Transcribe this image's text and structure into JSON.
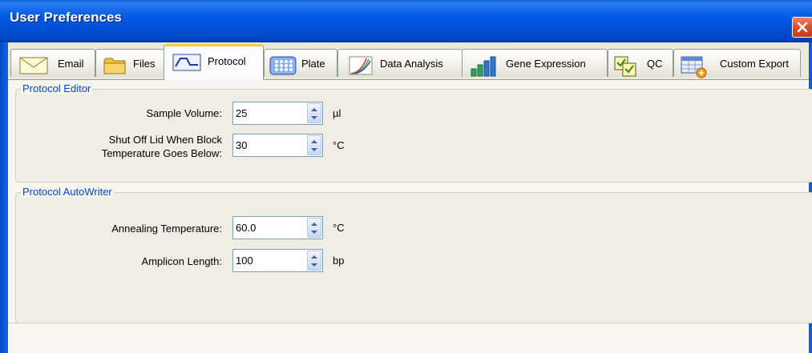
{
  "window": {
    "title": "User Preferences",
    "close_icon": "close-icon"
  },
  "tabs": [
    {
      "label": "Email",
      "icon": "envelope-icon",
      "active": false
    },
    {
      "label": "Files",
      "icon": "folder-icon",
      "active": false
    },
    {
      "label": "Protocol",
      "icon": "protocol-wave-icon",
      "active": true
    },
    {
      "label": "Plate",
      "icon": "plate-grid-icon",
      "active": false
    },
    {
      "label": "Data Analysis",
      "icon": "data-analysis-curves-icon",
      "active": false
    },
    {
      "label": "Gene Expression",
      "icon": "bar-chart-icon",
      "active": false
    },
    {
      "label": "QC",
      "icon": "qc-checkboxes-icon",
      "active": false
    },
    {
      "label": "Custom Export",
      "icon": "export-table-icon",
      "active": false
    }
  ],
  "protocol_editor": {
    "title": "Protocol Editor",
    "sample_volume": {
      "label": "Sample Volume:",
      "value": "25",
      "unit": "µl"
    },
    "shut_off_lid": {
      "label_line1": "Shut Off Lid When Block",
      "label_line2": "Temperature Goes Below:",
      "value": "30",
      "unit": "°C"
    }
  },
  "protocol_autowriter": {
    "title": "Protocol AutoWriter",
    "annealing_temperature": {
      "label": "Annealing Temperature:",
      "value": "60.0",
      "unit": "°C"
    },
    "amplicon_length": {
      "label": "Amplicon Length:",
      "value": "100",
      "unit": "bp"
    }
  },
  "colors": {
    "titlebar": "#0058e6",
    "group_title": "#0046d5",
    "active_tab_highlight": "#ffc83c",
    "close_button": "#d8502c"
  }
}
